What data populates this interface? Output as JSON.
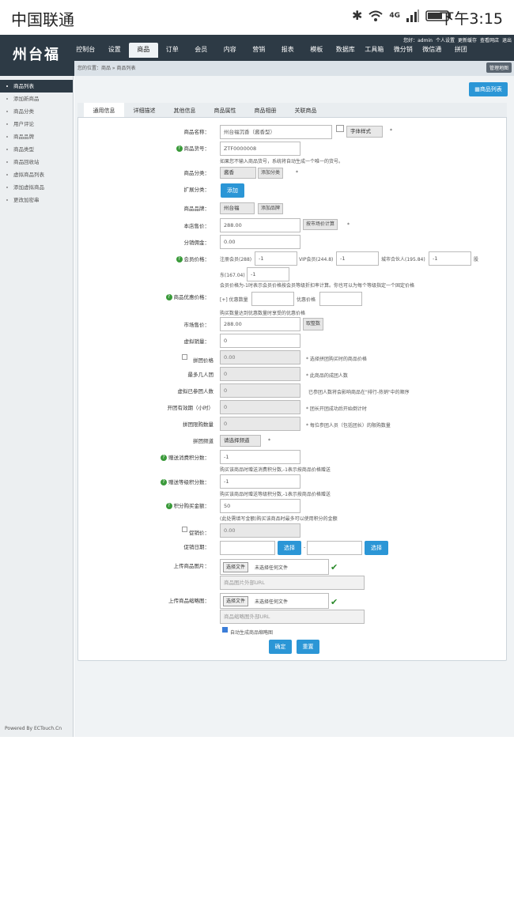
{
  "status_bar": {
    "carrier": "中国联通",
    "time": "下午3:15",
    "network": "4G"
  },
  "brand": "州台福",
  "user_links": [
    "您好：admin",
    "个人设置",
    "更新缓存",
    "查看网店",
    "退出"
  ],
  "nav": [
    "控制台",
    "设置",
    "商品",
    "订单",
    "会员",
    "内容",
    "营销",
    "报表",
    "模板",
    "数据库",
    "工具箱",
    "微分销",
    "微信通",
    "拼团"
  ],
  "nav_active": 2,
  "breadcrumb": "您的位置：商品 » 商品列表",
  "map_button": "管理地图",
  "sidebar": [
    "商品列表",
    "添加新商品",
    "商品分类",
    "用户评论",
    "商品品牌",
    "商品类型",
    "商品回收站",
    "虚拟商品列表",
    "添加虚拟商品",
    "更改加密串"
  ],
  "powered": "Powered By ECTouch.Cn",
  "list_button": "商品列表",
  "tabs": [
    "通用信息",
    "详细描述",
    "其他信息",
    "商品属性",
    "商品相册",
    "关联商品"
  ],
  "form": {
    "goods_name_label": "商品名称：",
    "goods_name_value": "州台福沉香（酱香型）",
    "font_style": "字体样式",
    "goods_sn_label": "商品货号：",
    "goods_sn_value": "ZTF0000008",
    "goods_sn_note": "如果您不输入商品货号，系统将自动生成一个唯一的货号。",
    "category_label": "商品分类：",
    "category_value": "酱香",
    "add_category": "添加分类",
    "ext_category_label": "扩展分类：",
    "add_button": "添加",
    "brand_label": "商品品牌：",
    "brand_value": "州台福",
    "add_brand": "添加品牌",
    "price_label": "本店售价：",
    "price_value": "288.00",
    "market_calc": "按市场价计算",
    "commission_label": "分销佣金：",
    "commission_value": "0.00",
    "member_price_label": "会员价格：",
    "member_prices": [
      {
        "name": "注册会员(288)",
        "value": "-1"
      },
      {
        "name": "VIP会员(244.8)",
        "value": "-1"
      },
      {
        "name": "城市合伙人(195.84)",
        "value": "-1"
      },
      {
        "name": "东(167.04)",
        "value": "-1"
      }
    ],
    "member_trail": "股",
    "member_note": "会员价格为-1时表示会员价格按会员等级折扣率计算。你也可以为每个等级指定一个固定价格",
    "discount_label": "商品优惠价格：",
    "discount_qty": "[+] 优惠数量",
    "discount_price": "优惠价格",
    "discount_note": "购买数量达到优惠数量时享受的优惠价格",
    "market_label": "市场售价：",
    "market_value": "288.00",
    "round_btn": "取整数",
    "virtual_sales_label": "虚拟销量：",
    "virtual_sales_value": "0",
    "group_price_label": "拼团价格",
    "group_price_value": "0.00",
    "group_price_note": "* 选择拼团购买时的商品价格",
    "min_group_label": "最多几人团",
    "min_group_value": "0",
    "min_group_note": "* 此商品的成团人数",
    "virtual_join_label": "虚拟已参团人数",
    "virtual_join_value": "0",
    "virtual_join_note": "已参团人数将会影响商品在\"排行-热销\"中的顺序",
    "group_valid_label": "开团有效期（小时）",
    "group_valid_value": "0",
    "group_valid_note": "* 团长开团成功后开始倒计时",
    "group_limit_label": "拼团限购数量",
    "group_limit_value": "0",
    "group_limit_note": "* 每位参团人员（包括团长）的限购数量",
    "group_channel_label": "拼团频道",
    "group_channel_value": "请选择频道",
    "give_points_label": "赠送消费积分数：",
    "give_points_value": "-1",
    "give_points_note": "购买该商品时赠送消费积分数,-1表示按商品价格赠送",
    "rank_points_label": "赠送等级积分数：",
    "rank_points_value": "-1",
    "rank_points_note": "购买该商品时赠送等级积分数,-1表示按商品价格赠送",
    "integral_label": "积分购买金额：",
    "integral_value": "50",
    "integral_note": "(此处需填写金额)购买该商品时最多可以使用积分的金额",
    "promote_label": "促销价：",
    "promote_value": "0.00",
    "promote_date_label": "促销日期：",
    "select_btn": "选择",
    "date_sep": "-",
    "upload_img_label": "上传商品图片：",
    "choose_file": "选择文件",
    "no_file": "未选择任何文件",
    "img_url_ph": "商品图片外部URL",
    "upload_thumb_label": "上传商品缩略图：",
    "thumb_url_ph": "商品缩略图外部URL",
    "auto_thumb": "自动生成商品缩略图",
    "confirm": "确定",
    "reset": "重置",
    "star": "*"
  }
}
